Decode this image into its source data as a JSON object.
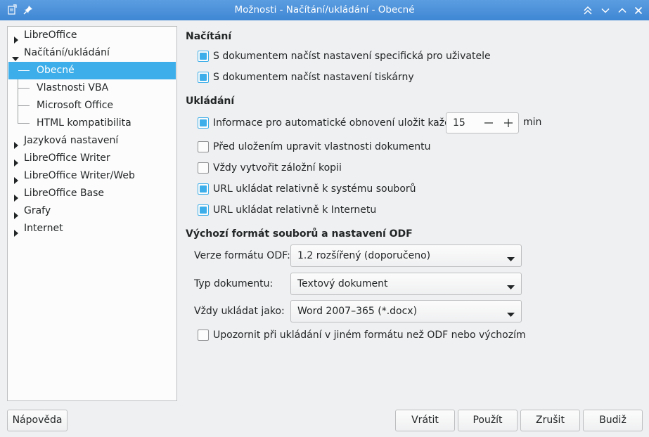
{
  "window": {
    "title": "Možnosti - Načítání/ukládání - Obecné"
  },
  "tree": {
    "items": [
      {
        "label": "LibreOffice",
        "level": 0,
        "expanded": false
      },
      {
        "label": "Načítání/ukládání",
        "level": 0,
        "expanded": true
      },
      {
        "label": "Obecné",
        "level": 1,
        "selected": true
      },
      {
        "label": "Vlastnosti VBA",
        "level": 1
      },
      {
        "label": "Microsoft Office",
        "level": 1
      },
      {
        "label": "HTML kompatibilita",
        "level": 1
      },
      {
        "label": "Jazyková nastavení",
        "level": 0,
        "expanded": false
      },
      {
        "label": "LibreOffice Writer",
        "level": 0,
        "expanded": false
      },
      {
        "label": "LibreOffice Writer/Web",
        "level": 0,
        "expanded": false
      },
      {
        "label": "LibreOffice Base",
        "level": 0,
        "expanded": false
      },
      {
        "label": "Grafy",
        "level": 0,
        "expanded": false
      },
      {
        "label": "Internet",
        "level": 0,
        "expanded": false
      }
    ]
  },
  "load": {
    "heading": "Načítání",
    "user_settings": {
      "label": "S dokumentem načíst nastavení specifická pro uživatele",
      "checked": true
    },
    "printer_settings": {
      "label": "S dokumentem načíst nastavení tiskárny",
      "checked": true
    }
  },
  "save": {
    "heading": "Ukládání",
    "autorecovery": {
      "label": "Informace pro automatické obnovení uložit každých:",
      "checked": true,
      "value": "15",
      "unit": "min"
    },
    "edit_properties": {
      "label": "Před uložením upravit vlastnosti dokumentu",
      "checked": false
    },
    "backup": {
      "label": "Vždy vytvořit záložní kopii",
      "checked": false
    },
    "url_filesystem": {
      "label": "URL ukládat relativně k systému souborů",
      "checked": true
    },
    "url_internet": {
      "label": "URL ukládat relativně k Internetu",
      "checked": true
    }
  },
  "odf": {
    "heading": "Výchozí formát souborů a nastavení ODF",
    "version": {
      "label": "Verze formátu ODF:",
      "value": "1.2 rozšířený (doporučeno)"
    },
    "doctype": {
      "label": "Typ dokumentu:",
      "value": "Textový dokument"
    },
    "save_as": {
      "label": "Vždy ukládat jako:",
      "value": "Word 2007–365 (*.docx)"
    },
    "warn": {
      "label": "Upozornit při ukládání v jiném formátu než ODF nebo výchozím",
      "checked": false
    }
  },
  "buttons": {
    "help": "Nápověda",
    "reset": "Vrátit",
    "apply": "Použít",
    "cancel": "Zrušit",
    "ok": "Budiž"
  },
  "colors": {
    "accent": "#3daee9",
    "titlebar": "#4a90d9"
  }
}
